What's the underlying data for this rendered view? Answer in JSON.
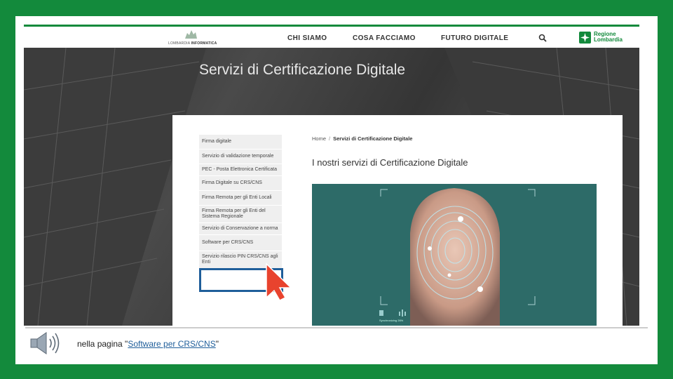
{
  "nav": {
    "logo_text_1": "LOMBARDIA",
    "logo_text_2": "INFORMATICA",
    "menu": [
      "CHI SIAMO",
      "COSA FACCIAMO",
      "FUTURO DIGITALE"
    ],
    "region_line_1": "Regione",
    "region_line_2": "Lombardia",
    "icons": {
      "search": "search-icon",
      "region": "regione-lombardia-logo"
    }
  },
  "hero": {
    "title": "Servizi di Certificazione Digitale"
  },
  "sidebar": {
    "items": [
      "Firma digitale",
      "Servizio di validazione temporale",
      "PEC - Posta Elettronica Certificata",
      "Firma Digitale su CRS/CNS",
      "Firma Remota per gli Enti Locali",
      "Firma Remota per gli Enti del Sistema Regionale",
      "Servizio di Conservazione a norma",
      "Software per CRS/CNS",
      "Servizio rilascio PIN CRS/CNS agli Enti"
    ]
  },
  "breadcrumb": {
    "home": "Home",
    "sep": "/",
    "current": "Servizi di Certificazione Digitale"
  },
  "content": {
    "title": "I nostri servizi di Certificazione Digitale",
    "image_overlay": "Synchronizing 26%"
  },
  "caption": {
    "prefix": "nella pagina \"",
    "link": "Software per CRS/CNS",
    "suffix": "\""
  },
  "colors": {
    "frame": "#138a3c",
    "highlight": "#1f5e9a",
    "cursor": "#e8432e"
  }
}
